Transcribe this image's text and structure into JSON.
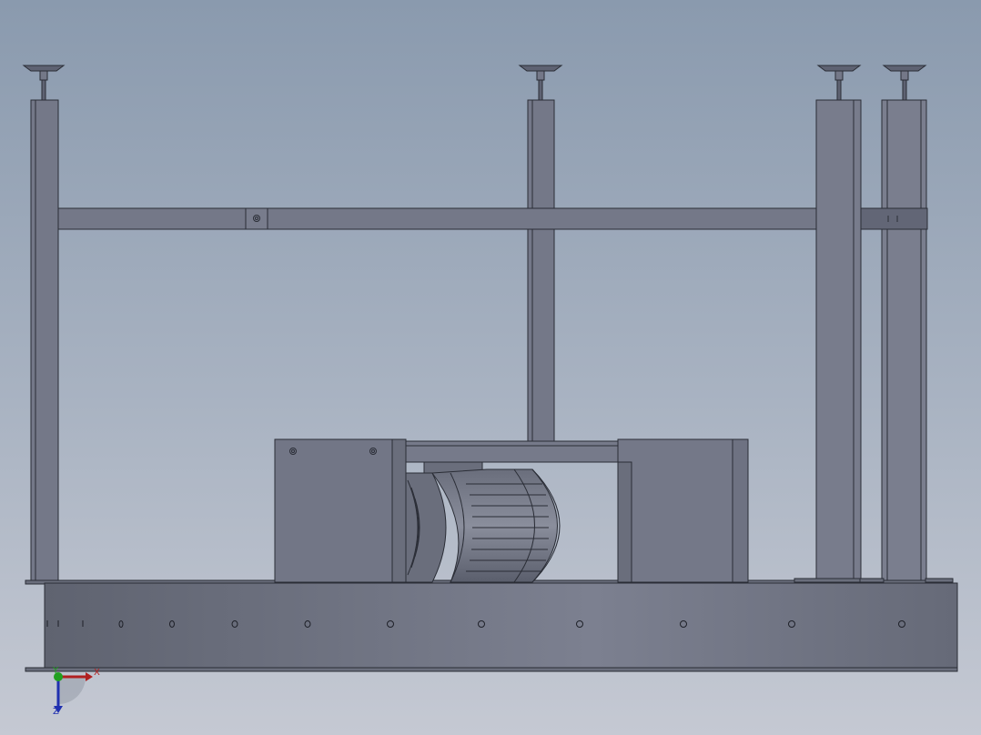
{
  "viewport": {
    "background_top": "#8a9aae",
    "background_bottom": "#c5c9d3",
    "part_fill": "#747888",
    "part_dark": "#5e6272",
    "edge_color": "#2a2d36"
  },
  "triad": {
    "x_label": "X",
    "y_label": "Y",
    "z_label": "Z",
    "x_color": "#b02020",
    "y_color": "#20a020",
    "z_color": "#2030b0"
  }
}
